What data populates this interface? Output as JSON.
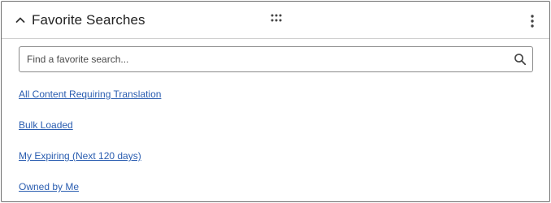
{
  "widget": {
    "title": "Favorite Searches",
    "icons": {
      "collapse": "chevron-up-icon",
      "drag": "drag-handle-icon",
      "menu": "more-vertical-icon",
      "search": "search-icon"
    }
  },
  "search": {
    "placeholder": "Find a favorite search...",
    "value": ""
  },
  "favorites": [
    {
      "label": "All Content Requiring Translation"
    },
    {
      "label": "Bulk Loaded"
    },
    {
      "label": "My Expiring (Next 120 days)"
    },
    {
      "label": "Owned by Me"
    }
  ],
  "colors": {
    "link": "#2a5db0",
    "border": "#6f6f6f",
    "text": "#222222"
  }
}
